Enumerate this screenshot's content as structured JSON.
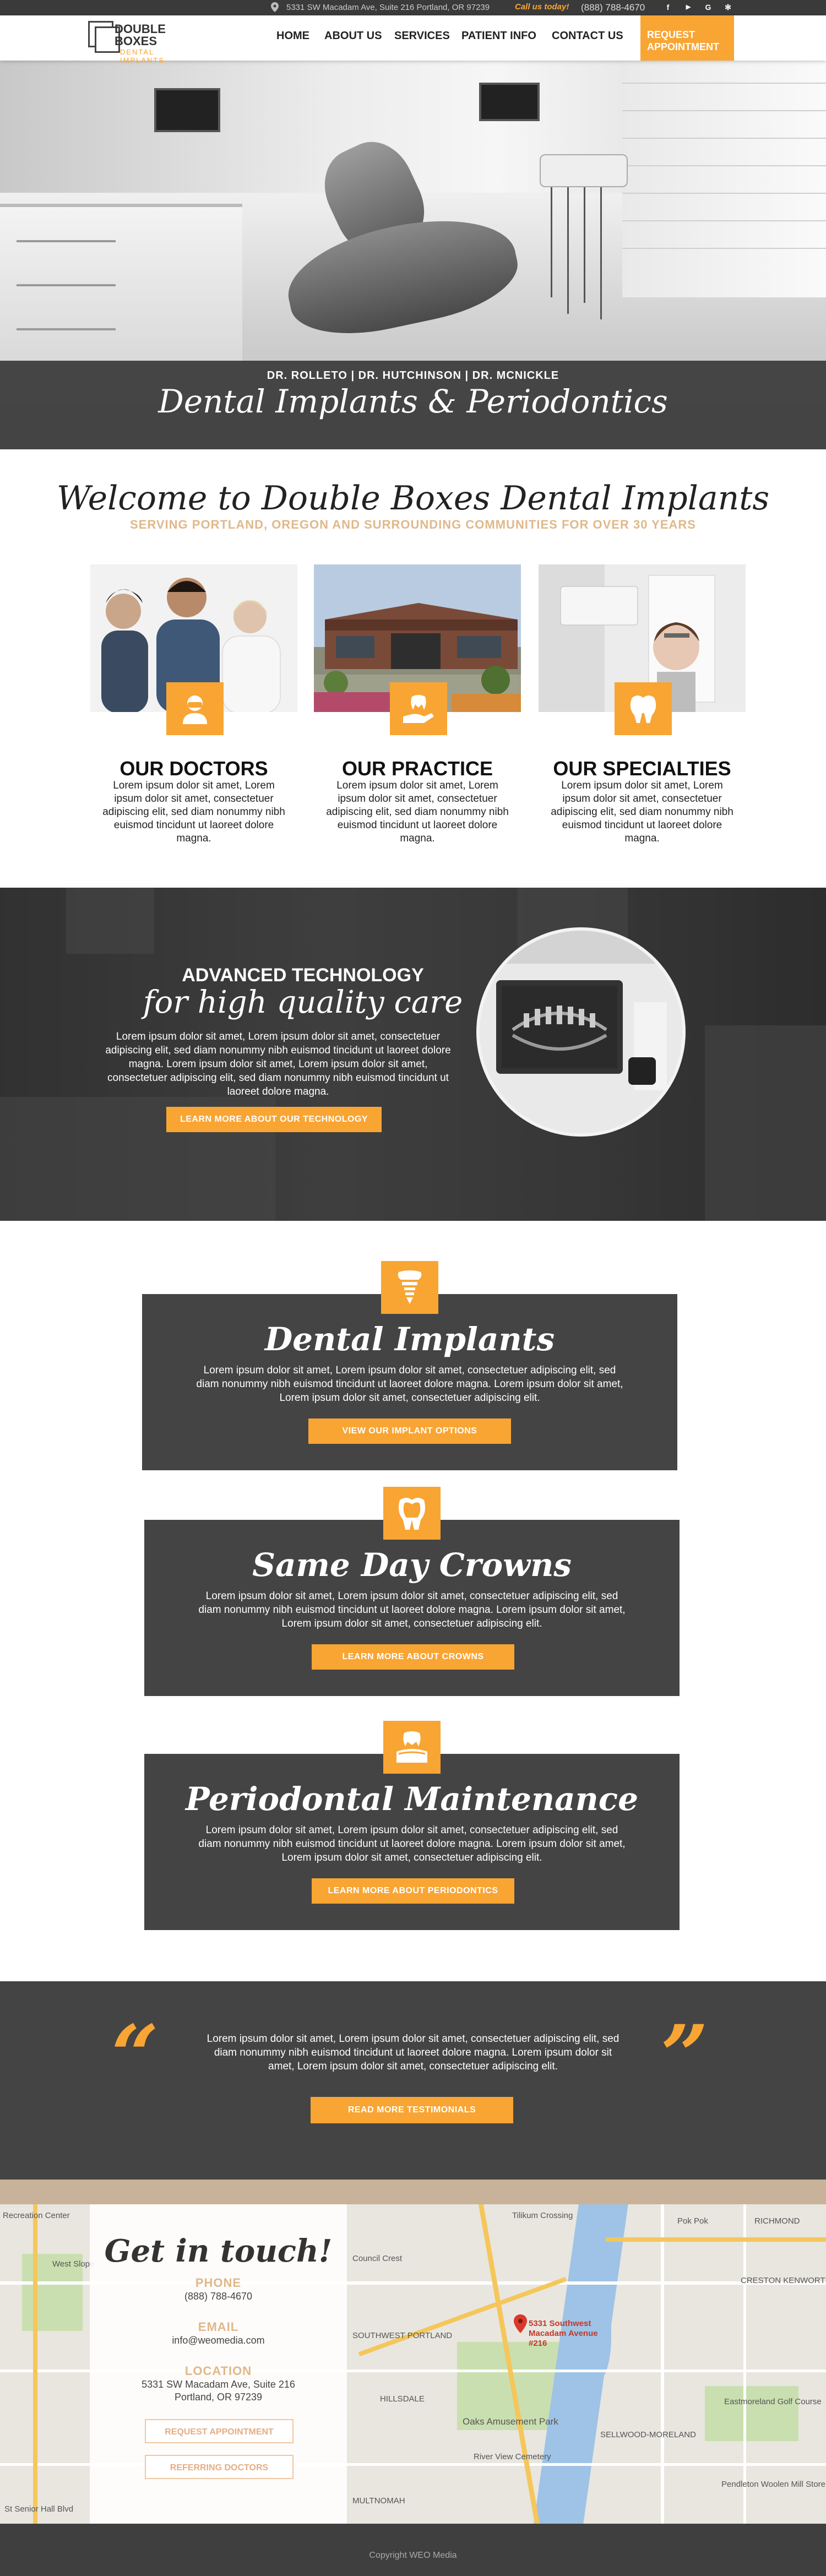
{
  "topbar": {
    "address": "5331 SW Macadam Ave, Suite 216 Portland, OR 97239",
    "call_label": "Call us today!",
    "phone": "(888) 788-4670",
    "social": [
      {
        "icon": "facebook-icon",
        "glyph": "f"
      },
      {
        "icon": "youtube-icon",
        "glyph": "▶"
      },
      {
        "icon": "google-icon",
        "glyph": "G"
      },
      {
        "icon": "yelp-icon",
        "glyph": "✻"
      }
    ]
  },
  "logo": {
    "line1": "DOUBLE",
    "line2": "BOXES",
    "line3": "DENTAL IMPLANTS"
  },
  "nav": {
    "items": [
      "HOME",
      "ABOUT US",
      "SERVICES",
      "PATIENT INFO",
      "CONTACT US"
    ],
    "cta": "REQUEST APPOINTMENT"
  },
  "hero": {
    "doctors": "DR. ROLLETO | DR. HUTCHINSON | DR. MCNICKLE",
    "title": "Dental Implants & Periodontics"
  },
  "welcome": {
    "title": "Welcome to Double Boxes Dental Implants",
    "subtitle": "SERVING PORTLAND, OREGON AND SURROUNDING COMMUNITIES FOR OVER 30 YEARS",
    "cards": [
      {
        "title": "OUR DOCTORS",
        "icon": "doctor-icon",
        "text": "Lorem ipsum dolor sit amet, Lorem ipsum dolor sit amet, consectetuer adipiscing elit, sed diam nonummy nibh euismod tincidunt ut laoreet dolore magna."
      },
      {
        "title": "OUR PRACTICE",
        "icon": "tooth-hand-icon",
        "text": "Lorem ipsum dolor sit amet, Lorem ipsum dolor sit amet, consectetuer adipiscing elit, sed diam nonummy nibh euismod tincidunt ut laoreet dolore magna."
      },
      {
        "title": "OUR SPECIALTIES",
        "icon": "tooth-icon",
        "text": "Lorem ipsum dolor sit amet, Lorem ipsum dolor sit amet, consectetuer adipiscing elit, sed diam nonummy nibh euismod tincidunt ut laoreet dolore magna."
      }
    ]
  },
  "tech": {
    "title1": "ADVANCED TECHNOLOGY",
    "title2": "for high quality care",
    "text": "Lorem ipsum dolor sit amet, Lorem ipsum dolor sit amet, consectetuer adipiscing elit, sed diam nonummy nibh euismod tincidunt ut laoreet dolore magna.  Lorem ipsum dolor sit amet, Lorem ipsum dolor sit amet, consectetuer adipiscing elit, sed diam nonummy nibh euismod tincidunt ut laoreet dolore magna.",
    "button": "LEARN MORE ABOUT OUR TECHNOLOGY"
  },
  "services": [
    {
      "title": "Dental Implants",
      "icon": "implant-icon",
      "text": "Lorem ipsum dolor sit amet, Lorem ipsum dolor sit amet, consectetuer adipiscing elit, sed diam nonummy nibh euismod tincidunt ut laoreet dolore magna.  Lorem ipsum dolor sit amet, Lorem ipsum dolor sit amet, consectetuer adipiscing elit.",
      "button": "VIEW OUR IMPLANT OPTIONS"
    },
    {
      "title": "Same Day Crowns",
      "icon": "crown-icon",
      "text": "Lorem ipsum dolor sit amet, Lorem ipsum dolor sit amet, consectetuer adipiscing elit, sed diam nonummy nibh euismod tincidunt ut laoreet dolore magna.  Lorem ipsum dolor sit amet, Lorem ipsum dolor sit amet, consectetuer adipiscing elit.",
      "button": "LEARN MORE ABOUT CROWNS"
    },
    {
      "title": "Periodontal Maintenance",
      "icon": "gum-care-icon",
      "text": "Lorem ipsum dolor sit amet, Lorem ipsum dolor sit amet, consectetuer adipiscing elit, sed diam nonummy nibh euismod tincidunt ut laoreet dolore magna.  Lorem ipsum dolor sit amet, Lorem ipsum dolor sit amet, consectetuer adipiscing elit.",
      "button": "LEARN MORE ABOUT PERIODONTICS"
    }
  ],
  "testimonials": {
    "text": "Lorem ipsum dolor sit amet, Lorem ipsum dolor sit amet, consectetuer adipiscing elit, sed diam nonummy nibh euismod tincidunt ut laoreet dolore magna.  Lorem ipsum dolor sit amet, Lorem ipsum dolor sit amet, consectetuer adipiscing elit.",
    "button": "READ MORE TESTIMONIALS",
    "open_quote": "“",
    "close_quote": "”"
  },
  "contact": {
    "title": "Get in touch!",
    "phone_label": "PHONE",
    "phone": "(888) 788-4670",
    "email_label": "EMAIL",
    "email": "info@weomedia.com",
    "location_label": "LOCATION",
    "address1": "5331 SW Macadam Ave, Suite 216",
    "address2": "Portland, OR 97239",
    "btn_appt": "REQUEST APPOINTMENT",
    "btn_ref": "REFERRING DOCTORS"
  },
  "map": {
    "marker_label": "5331 Southwest Macadam Avenue #216",
    "labels": [
      "Recreation Center",
      "West Slope",
      "Tilikum Crossing",
      "Pok Pok",
      "RICHMOND",
      "CRESTON KENWORTH",
      "SOUTHWEST PORTLAND",
      "HILLSDALE",
      "Oaks Amusement Park",
      "River View Cemetery",
      "SELLWOOD-MORELAND",
      "Eastmoreland Golf Course",
      "Pendleton Woolen Mill Store",
      "MULTNOMAH",
      "St Senior Hall Blvd",
      "Council Crest"
    ]
  },
  "footer": {
    "copyright": "Copyright WEO Media"
  }
}
